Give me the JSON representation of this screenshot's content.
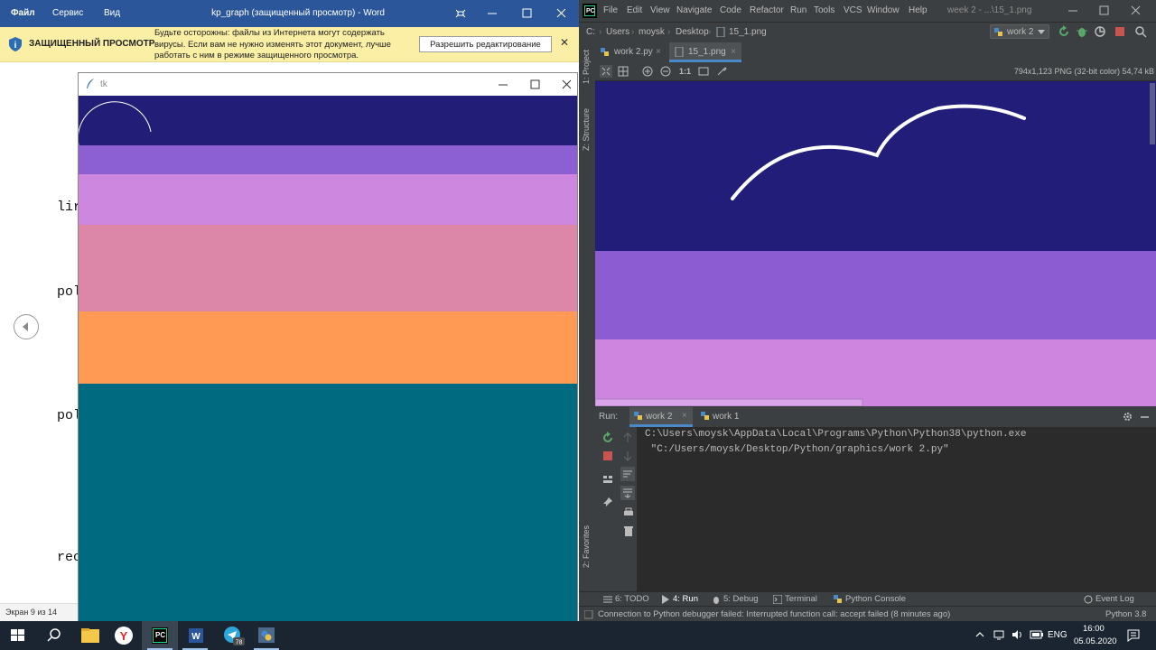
{
  "word": {
    "menu": [
      "Файл",
      "Сервис",
      "Вид"
    ],
    "title": "kp_graph (защищенный просмотр) - Word",
    "banner_title": "ЗАЩИЩЕННЫЙ ПРОСМОТР",
    "banner_text": "Будьте осторожны: файлы из Интернета могут содержать вирусы. Если вам не нужно изменять этот документ, лучше работать с ним в режиме защищенного просмотра.",
    "allow_button": "Разрешить редактирование",
    "close_glyph": "✕",
    "code_fragments": [
      "lir",
      "pol",
      "pol",
      "rec"
    ],
    "status": "Экран 9 из 14"
  },
  "tk": {
    "title": "tk",
    "bands": [
      {
        "color": "#221e78",
        "weight": 55
      },
      {
        "color": "#8c5fd2",
        "weight": 32
      },
      {
        "color": "#cd87df",
        "weight": 56
      },
      {
        "color": "#dd87a8",
        "weight": 96
      },
      {
        "color": "#ff9a55",
        "weight": 80
      },
      {
        "color": "#006a80",
        "weight": 266
      }
    ]
  },
  "pycharm": {
    "menu": [
      "File",
      "Edit",
      "View",
      "Navigate",
      "Code",
      "Refactor",
      "Run",
      "Tools",
      "VCS",
      "Window",
      "Help"
    ],
    "title": "week 2 - ...\\15_1.png",
    "breadcrumbs": [
      "C:",
      "Users",
      "moysk",
      "Desktop",
      "15_1.png"
    ],
    "run_config": "work 2",
    "tabs": [
      {
        "label": "work 2.py",
        "active": false
      },
      {
        "label": "15_1.png",
        "active": true
      }
    ],
    "zoom_label": "1:1",
    "image_info": "794x1,123 PNG (32-bit color) 54,74 kB",
    "side_panels": [
      "1: Project",
      "Z: Structure",
      "2: Favorites"
    ],
    "image_bands": [
      {
        "color": "#211d79",
        "weight": 188
      },
      {
        "color": "#8c5cd3",
        "weight": 98
      },
      {
        "color": "#cd85df",
        "weight": 74
      }
    ],
    "run": {
      "label": "Run:",
      "tabs": [
        "work 2",
        "work 1"
      ],
      "console_lines": [
        "C:\\Users\\moysk\\AppData\\Local\\Programs\\Python\\Python38\\python.exe",
        " \"C:/Users/moysk/Desktop/Python/graphics/work 2.py\""
      ]
    },
    "bottom_tools": [
      "6: TODO",
      "4: Run",
      "5: Debug",
      "Terminal",
      "Python Console"
    ],
    "event_log": "Event Log",
    "status_message": "Connection to Python debugger failed: Interrupted function call: accept failed (8 minutes ago)",
    "interpreter": "Python 3.8"
  },
  "taskbar": {
    "badge": "78",
    "language": "ENG",
    "time": "16:00",
    "date": "05.05.2020"
  }
}
